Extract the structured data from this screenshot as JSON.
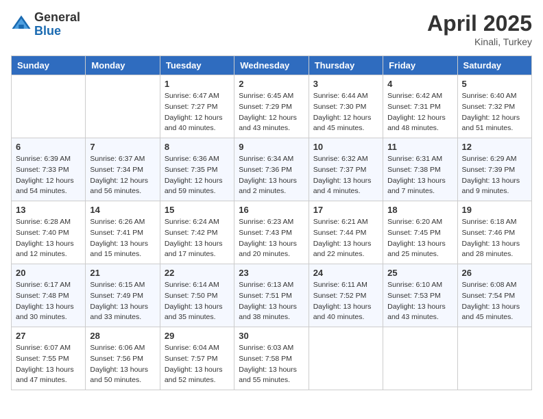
{
  "header": {
    "logo_general": "General",
    "logo_blue": "Blue",
    "month_title": "April 2025",
    "subtitle": "Kinali, Turkey"
  },
  "days_of_week": [
    "Sunday",
    "Monday",
    "Tuesday",
    "Wednesday",
    "Thursday",
    "Friday",
    "Saturday"
  ],
  "weeks": [
    [
      {
        "day": "",
        "info": ""
      },
      {
        "day": "",
        "info": ""
      },
      {
        "day": "1",
        "info": "Sunrise: 6:47 AM\nSunset: 7:27 PM\nDaylight: 12 hours and 40 minutes."
      },
      {
        "day": "2",
        "info": "Sunrise: 6:45 AM\nSunset: 7:29 PM\nDaylight: 12 hours and 43 minutes."
      },
      {
        "day": "3",
        "info": "Sunrise: 6:44 AM\nSunset: 7:30 PM\nDaylight: 12 hours and 45 minutes."
      },
      {
        "day": "4",
        "info": "Sunrise: 6:42 AM\nSunset: 7:31 PM\nDaylight: 12 hours and 48 minutes."
      },
      {
        "day": "5",
        "info": "Sunrise: 6:40 AM\nSunset: 7:32 PM\nDaylight: 12 hours and 51 minutes."
      }
    ],
    [
      {
        "day": "6",
        "info": "Sunrise: 6:39 AM\nSunset: 7:33 PM\nDaylight: 12 hours and 54 minutes."
      },
      {
        "day": "7",
        "info": "Sunrise: 6:37 AM\nSunset: 7:34 PM\nDaylight: 12 hours and 56 minutes."
      },
      {
        "day": "8",
        "info": "Sunrise: 6:36 AM\nSunset: 7:35 PM\nDaylight: 12 hours and 59 minutes."
      },
      {
        "day": "9",
        "info": "Sunrise: 6:34 AM\nSunset: 7:36 PM\nDaylight: 13 hours and 2 minutes."
      },
      {
        "day": "10",
        "info": "Sunrise: 6:32 AM\nSunset: 7:37 PM\nDaylight: 13 hours and 4 minutes."
      },
      {
        "day": "11",
        "info": "Sunrise: 6:31 AM\nSunset: 7:38 PM\nDaylight: 13 hours and 7 minutes."
      },
      {
        "day": "12",
        "info": "Sunrise: 6:29 AM\nSunset: 7:39 PM\nDaylight: 13 hours and 9 minutes."
      }
    ],
    [
      {
        "day": "13",
        "info": "Sunrise: 6:28 AM\nSunset: 7:40 PM\nDaylight: 13 hours and 12 minutes."
      },
      {
        "day": "14",
        "info": "Sunrise: 6:26 AM\nSunset: 7:41 PM\nDaylight: 13 hours and 15 minutes."
      },
      {
        "day": "15",
        "info": "Sunrise: 6:24 AM\nSunset: 7:42 PM\nDaylight: 13 hours and 17 minutes."
      },
      {
        "day": "16",
        "info": "Sunrise: 6:23 AM\nSunset: 7:43 PM\nDaylight: 13 hours and 20 minutes."
      },
      {
        "day": "17",
        "info": "Sunrise: 6:21 AM\nSunset: 7:44 PM\nDaylight: 13 hours and 22 minutes."
      },
      {
        "day": "18",
        "info": "Sunrise: 6:20 AM\nSunset: 7:45 PM\nDaylight: 13 hours and 25 minutes."
      },
      {
        "day": "19",
        "info": "Sunrise: 6:18 AM\nSunset: 7:46 PM\nDaylight: 13 hours and 28 minutes."
      }
    ],
    [
      {
        "day": "20",
        "info": "Sunrise: 6:17 AM\nSunset: 7:48 PM\nDaylight: 13 hours and 30 minutes."
      },
      {
        "day": "21",
        "info": "Sunrise: 6:15 AM\nSunset: 7:49 PM\nDaylight: 13 hours and 33 minutes."
      },
      {
        "day": "22",
        "info": "Sunrise: 6:14 AM\nSunset: 7:50 PM\nDaylight: 13 hours and 35 minutes."
      },
      {
        "day": "23",
        "info": "Sunrise: 6:13 AM\nSunset: 7:51 PM\nDaylight: 13 hours and 38 minutes."
      },
      {
        "day": "24",
        "info": "Sunrise: 6:11 AM\nSunset: 7:52 PM\nDaylight: 13 hours and 40 minutes."
      },
      {
        "day": "25",
        "info": "Sunrise: 6:10 AM\nSunset: 7:53 PM\nDaylight: 13 hours and 43 minutes."
      },
      {
        "day": "26",
        "info": "Sunrise: 6:08 AM\nSunset: 7:54 PM\nDaylight: 13 hours and 45 minutes."
      }
    ],
    [
      {
        "day": "27",
        "info": "Sunrise: 6:07 AM\nSunset: 7:55 PM\nDaylight: 13 hours and 47 minutes."
      },
      {
        "day": "28",
        "info": "Sunrise: 6:06 AM\nSunset: 7:56 PM\nDaylight: 13 hours and 50 minutes."
      },
      {
        "day": "29",
        "info": "Sunrise: 6:04 AM\nSunset: 7:57 PM\nDaylight: 13 hours and 52 minutes."
      },
      {
        "day": "30",
        "info": "Sunrise: 6:03 AM\nSunset: 7:58 PM\nDaylight: 13 hours and 55 minutes."
      },
      {
        "day": "",
        "info": ""
      },
      {
        "day": "",
        "info": ""
      },
      {
        "day": "",
        "info": ""
      }
    ]
  ]
}
